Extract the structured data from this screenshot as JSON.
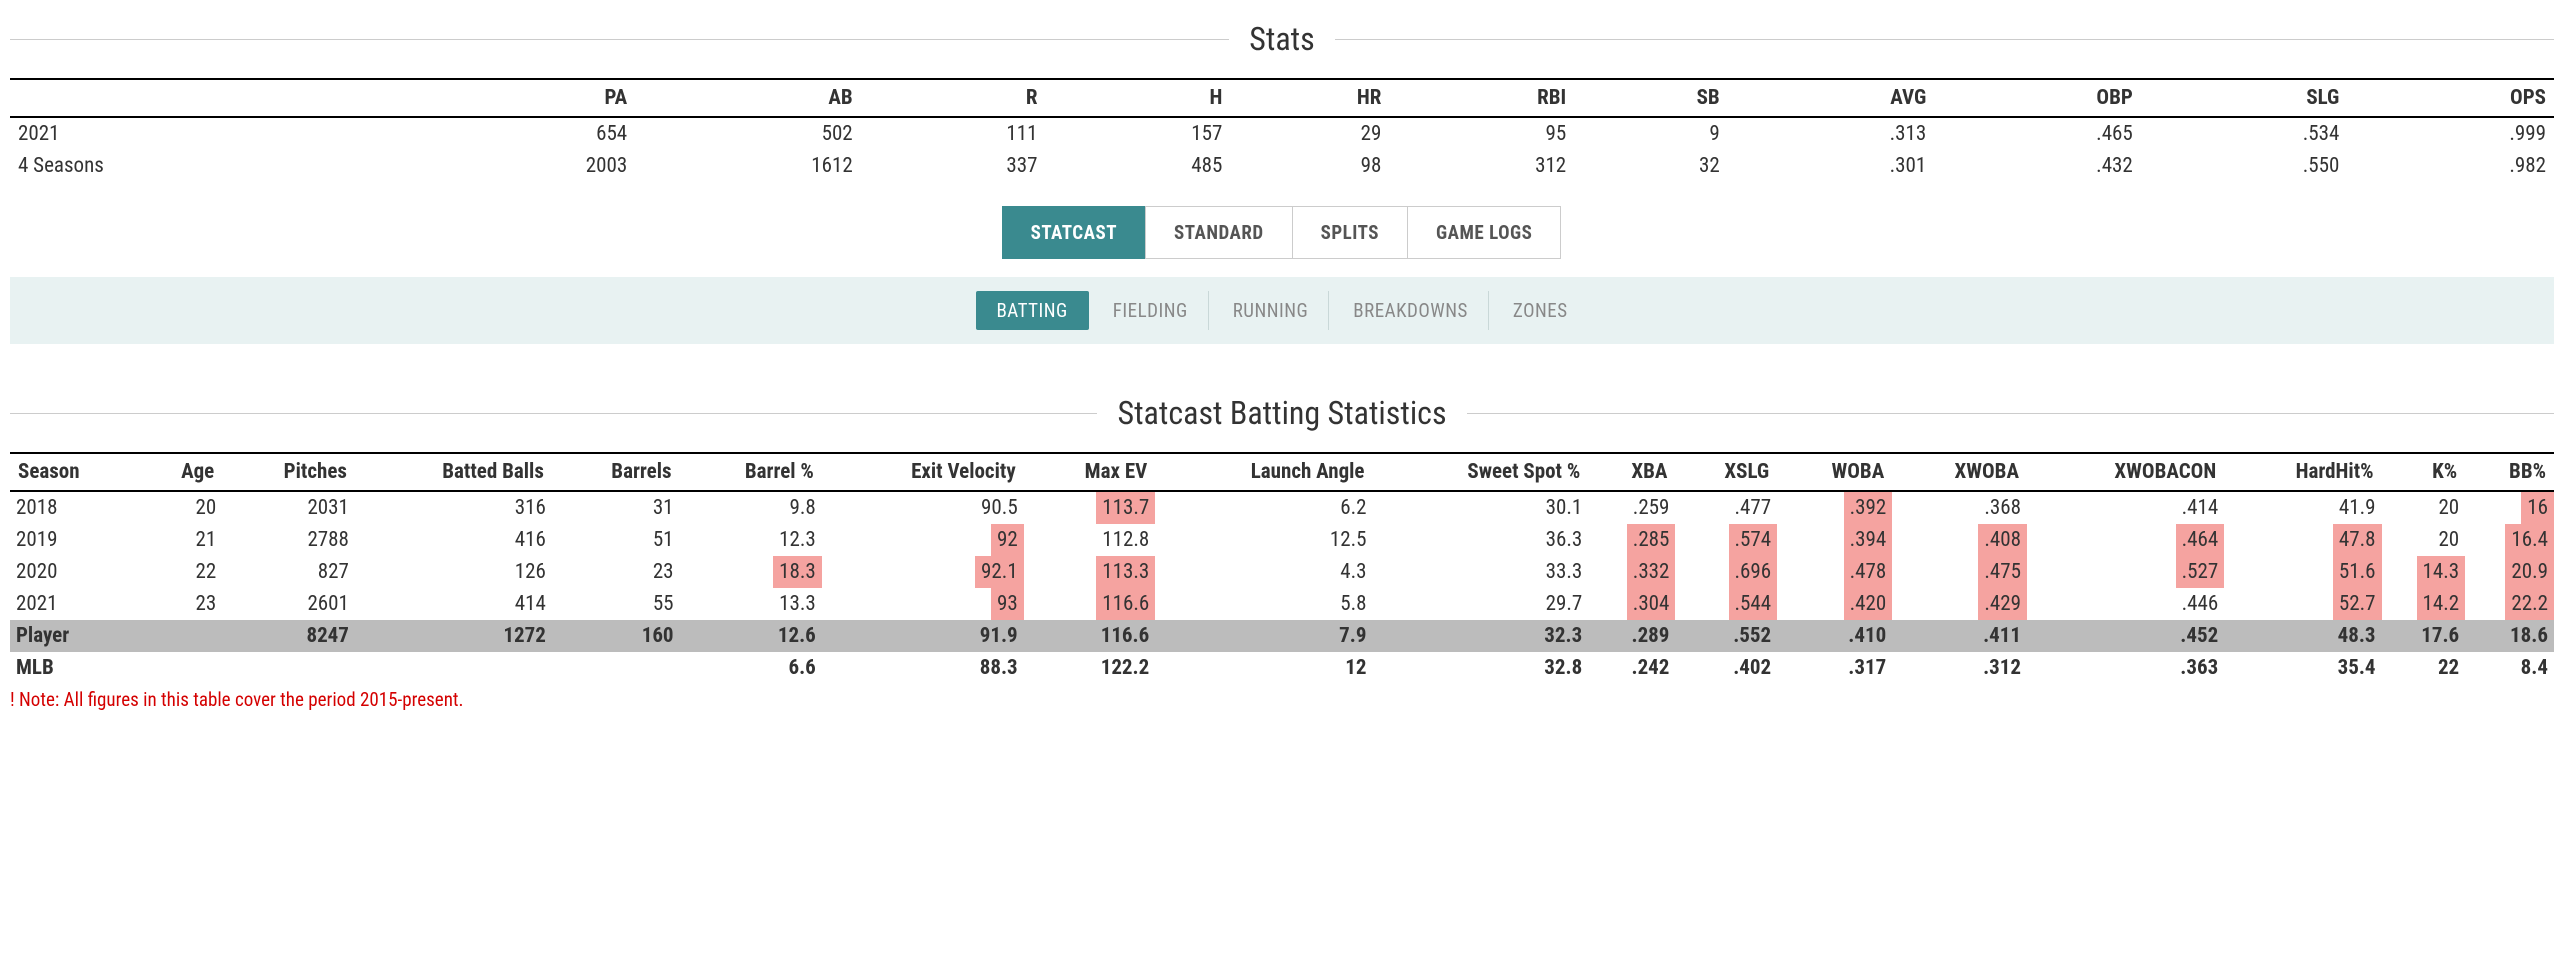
{
  "section1": {
    "title": "Stats"
  },
  "stats_table": {
    "headers": [
      "",
      "PA",
      "AB",
      "R",
      "H",
      "HR",
      "RBI",
      "SB",
      "AVG",
      "OBP",
      "SLG",
      "OPS"
    ],
    "rows": [
      {
        "label": "2021",
        "cells": [
          "654",
          "502",
          "111",
          "157",
          "29",
          "95",
          "9",
          ".313",
          ".465",
          ".534",
          ".999"
        ]
      },
      {
        "label": "4 Seasons",
        "cells": [
          "2003",
          "1612",
          "337",
          "485",
          "98",
          "312",
          "32",
          ".301",
          ".432",
          ".550",
          ".982"
        ]
      }
    ]
  },
  "tabs": {
    "items": [
      {
        "label": "STATCAST",
        "active": true
      },
      {
        "label": "STANDARD",
        "active": false
      },
      {
        "label": "SPLITS",
        "active": false
      },
      {
        "label": "GAME LOGS",
        "active": false
      }
    ]
  },
  "subtabs": {
    "items": [
      {
        "label": "BATTING",
        "active": true
      },
      {
        "label": "FIELDING",
        "active": false
      },
      {
        "label": "RUNNING",
        "active": false
      },
      {
        "label": "BREAKDOWNS",
        "active": false
      },
      {
        "label": "ZONES",
        "active": false
      }
    ]
  },
  "section2": {
    "title": "Statcast Batting Statistics"
  },
  "statcast_table": {
    "headers": [
      "Season",
      "Age",
      "Pitches",
      "Batted Balls",
      "Barrels",
      "Barrel %",
      "Exit Velocity",
      "Max EV",
      "Launch Angle",
      "Sweet Spot %",
      "XBA",
      "XSLG",
      "WOBA",
      "XWOBA",
      "XWOBACON",
      "HardHit%",
      "K%",
      "BB%"
    ],
    "rows": [
      {
        "kind": "data",
        "cells": [
          {
            "v": "2018"
          },
          {
            "v": "20"
          },
          {
            "v": "2031"
          },
          {
            "v": "316"
          },
          {
            "v": "31"
          },
          {
            "v": "9.8"
          },
          {
            "v": "90.5"
          },
          {
            "v": "113.7",
            "hl": true
          },
          {
            "v": "6.2"
          },
          {
            "v": "30.1"
          },
          {
            "v": ".259"
          },
          {
            "v": ".477"
          },
          {
            "v": ".392",
            "hl": true
          },
          {
            "v": ".368"
          },
          {
            "v": ".414"
          },
          {
            "v": "41.9"
          },
          {
            "v": "20"
          },
          {
            "v": "16",
            "hl": true
          }
        ]
      },
      {
        "kind": "data",
        "cells": [
          {
            "v": "2019"
          },
          {
            "v": "21"
          },
          {
            "v": "2788"
          },
          {
            "v": "416"
          },
          {
            "v": "51"
          },
          {
            "v": "12.3"
          },
          {
            "v": "92",
            "hl": true
          },
          {
            "v": "112.8"
          },
          {
            "v": "12.5"
          },
          {
            "v": "36.3"
          },
          {
            "v": ".285",
            "hl": true
          },
          {
            "v": ".574",
            "hl": true
          },
          {
            "v": ".394",
            "hl": true
          },
          {
            "v": ".408",
            "hl": true
          },
          {
            "v": ".464",
            "hl": true
          },
          {
            "v": "47.8",
            "hl": true
          },
          {
            "v": "20"
          },
          {
            "v": "16.4",
            "hl": true
          }
        ]
      },
      {
        "kind": "data",
        "cells": [
          {
            "v": "2020"
          },
          {
            "v": "22"
          },
          {
            "v": "827"
          },
          {
            "v": "126"
          },
          {
            "v": "23"
          },
          {
            "v": "18.3",
            "hl": true
          },
          {
            "v": "92.1",
            "hl": true
          },
          {
            "v": "113.3",
            "hl": true
          },
          {
            "v": "4.3"
          },
          {
            "v": "33.3"
          },
          {
            "v": ".332",
            "hl": true
          },
          {
            "v": ".696",
            "hl": true
          },
          {
            "v": ".478",
            "hl": true
          },
          {
            "v": ".475",
            "hl": true
          },
          {
            "v": ".527",
            "hl": true
          },
          {
            "v": "51.6",
            "hl": true
          },
          {
            "v": "14.3",
            "hl": true
          },
          {
            "v": "20.9",
            "hl": true
          }
        ]
      },
      {
        "kind": "data",
        "cells": [
          {
            "v": "2021"
          },
          {
            "v": "23"
          },
          {
            "v": "2601"
          },
          {
            "v": "414"
          },
          {
            "v": "55"
          },
          {
            "v": "13.3"
          },
          {
            "v": "93",
            "hl": true
          },
          {
            "v": "116.6",
            "hl": true
          },
          {
            "v": "5.8"
          },
          {
            "v": "29.7"
          },
          {
            "v": ".304",
            "hl": true
          },
          {
            "v": ".544",
            "hl": true
          },
          {
            "v": ".420",
            "hl": true
          },
          {
            "v": ".429",
            "hl": true
          },
          {
            "v": ".446"
          },
          {
            "v": "52.7",
            "hl": true
          },
          {
            "v": "14.2",
            "hl": true
          },
          {
            "v": "22.2",
            "hl": true
          }
        ]
      },
      {
        "kind": "summary",
        "cells": [
          {
            "v": "Player"
          },
          {
            "v": ""
          },
          {
            "v": "8247"
          },
          {
            "v": "1272"
          },
          {
            "v": "160"
          },
          {
            "v": "12.6"
          },
          {
            "v": "91.9"
          },
          {
            "v": "116.6"
          },
          {
            "v": "7.9"
          },
          {
            "v": "32.3"
          },
          {
            "v": ".289"
          },
          {
            "v": ".552"
          },
          {
            "v": ".410"
          },
          {
            "v": ".411"
          },
          {
            "v": ".452"
          },
          {
            "v": "48.3"
          },
          {
            "v": "17.6"
          },
          {
            "v": "18.6"
          }
        ]
      },
      {
        "kind": "mlb",
        "cells": [
          {
            "v": "MLB"
          },
          {
            "v": ""
          },
          {
            "v": ""
          },
          {
            "v": ""
          },
          {
            "v": ""
          },
          {
            "v": "6.6"
          },
          {
            "v": "88.3"
          },
          {
            "v": "122.2"
          },
          {
            "v": "12"
          },
          {
            "v": "32.8"
          },
          {
            "v": ".242"
          },
          {
            "v": ".402"
          },
          {
            "v": ".317"
          },
          {
            "v": ".312"
          },
          {
            "v": ".363"
          },
          {
            "v": "35.4"
          },
          {
            "v": "22"
          },
          {
            "v": "8.4"
          }
        ]
      }
    ]
  },
  "footnote": "! Note: All figures in this table cover the period 2015-present."
}
